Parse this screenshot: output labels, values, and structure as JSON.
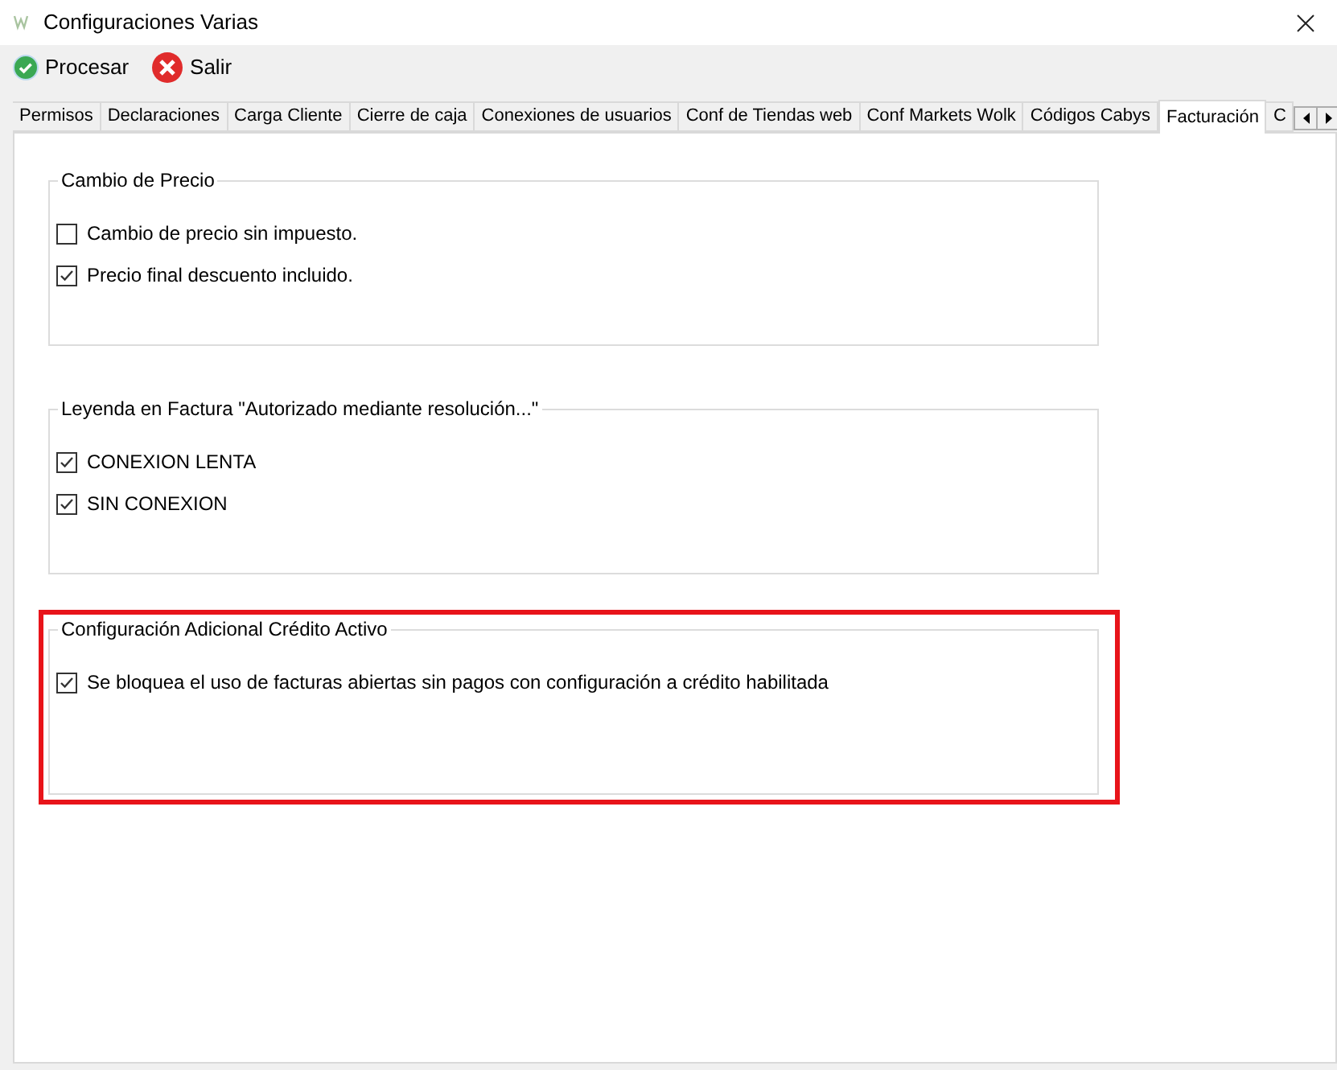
{
  "window": {
    "title": "Configuraciones Varias"
  },
  "toolbar": [
    {
      "kind": "ok",
      "label": "Procesar"
    },
    {
      "kind": "exit",
      "label": "Salir"
    }
  ],
  "tabs": [
    {
      "label": "Permisos",
      "selected": false
    },
    {
      "label": "Declaraciones",
      "selected": false
    },
    {
      "label": "Carga Cliente",
      "selected": false
    },
    {
      "label": "Cierre de caja",
      "selected": false
    },
    {
      "label": "Conexiones de usuarios",
      "selected": false
    },
    {
      "label": "Conf de Tiendas web",
      "selected": false
    },
    {
      "label": "Conf Markets Wolk",
      "selected": false
    },
    {
      "label": "Códigos Cabys",
      "selected": false
    },
    {
      "label": "Facturación",
      "selected": true
    },
    {
      "label": "C",
      "selected": false
    }
  ],
  "groups": [
    {
      "title": "Cambio de Precio",
      "highlighted": false,
      "options": [
        {
          "label": "Cambio de precio sin impuesto.",
          "checked": false
        },
        {
          "label": "Precio final descuento incluido.",
          "checked": true
        }
      ]
    },
    {
      "title": "Leyenda en Factura \"Autorizado mediante resolución...\"",
      "highlighted": false,
      "options": [
        {
          "label": "CONEXION LENTA",
          "checked": true
        },
        {
          "label": "SIN CONEXION",
          "checked": true
        }
      ]
    },
    {
      "title": "Configuración Adicional Crédito Activo",
      "highlighted": true,
      "options": [
        {
          "label": "Se bloquea el uso de facturas abiertas sin pagos con configuración a crédito habilitada",
          "checked": true
        }
      ]
    }
  ]
}
